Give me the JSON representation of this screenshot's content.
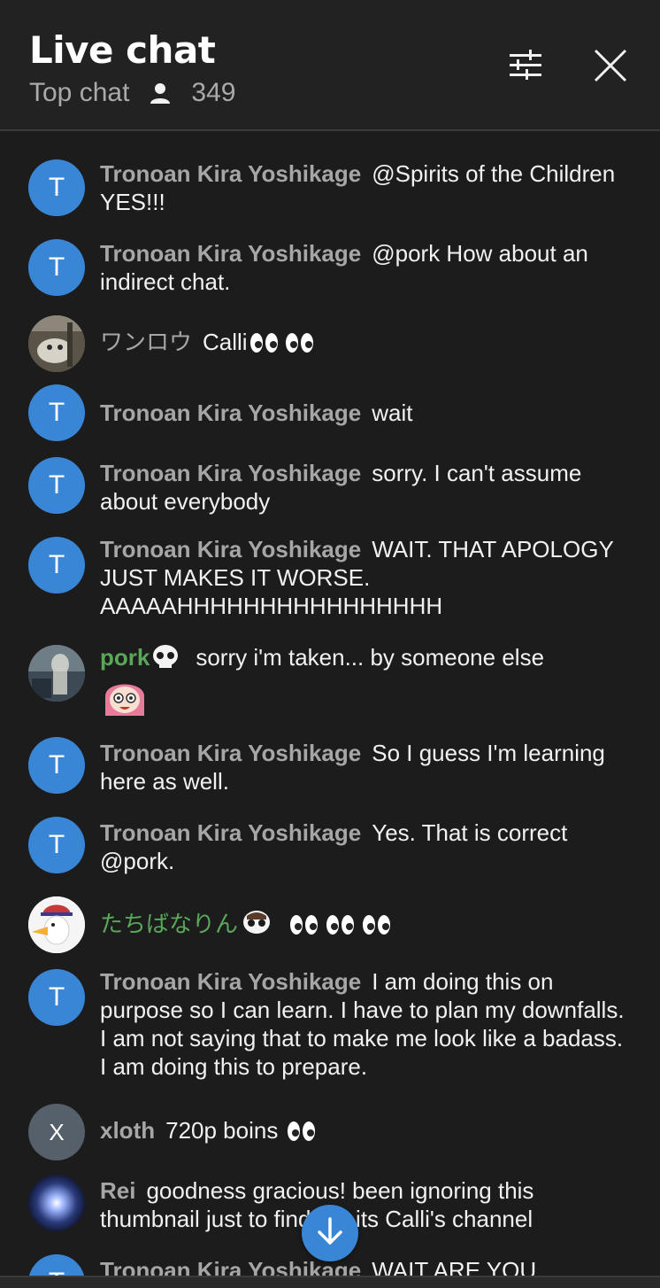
{
  "header": {
    "title": "Live chat",
    "mode_label": "Top chat",
    "viewer_count": "349"
  },
  "colors": {
    "accent": "#3a86d6",
    "author_grey": "#a6a6a6",
    "author_member_green": "#5aa75a",
    "background": "#1c1c1d"
  },
  "icons": {
    "viewers": "person-icon",
    "filter": "sliders-icon",
    "close": "close-icon",
    "scroll_down": "arrow-down-icon"
  },
  "messages": [
    {
      "avatar_letter": "T",
      "author": "Tronoan Kira Yoshikage",
      "text": "@Spirits of the Children YES!!!"
    },
    {
      "avatar_letter": "T",
      "author": "Tronoan Kira Yoshikage",
      "text": "@pork How about an indirect chat."
    },
    {
      "avatar_letter": "",
      "author": "ワンロウ",
      "text": "Calli",
      "emoji": "eyes-emoji eyes-emoji"
    },
    {
      "avatar_letter": "T",
      "author": "Tronoan Kira Yoshikage",
      "text": "wait"
    },
    {
      "avatar_letter": "T",
      "author": "Tronoan Kira Yoshikage",
      "text": "sorry. I can't assume about everybody"
    },
    {
      "avatar_letter": "T",
      "author": "Tronoan Kira Yoshikage",
      "text": "WAIT. THAT APOLOGY JUST MAKES IT WORSE. AAAAAHHHHHHHHHHHHHHHH"
    },
    {
      "avatar_letter": "",
      "author": "pork",
      "text": "sorry i'm taken... by someone else",
      "badge": "skull-badge-icon",
      "emoji": "pink-hair-girl-emote"
    },
    {
      "avatar_letter": "T",
      "author": "Tronoan Kira Yoshikage",
      "text": "So I guess I'm learning here as well."
    },
    {
      "avatar_letter": "T",
      "author": "Tronoan Kira Yoshikage",
      "text": "Yes. That is correct @pork."
    },
    {
      "avatar_letter": "",
      "author": "たちばなりん",
      "text": "",
      "badge": "skull-badge-icon",
      "emoji": "eyes-emoji eyes-emoji eyes-emoji"
    },
    {
      "avatar_letter": "T",
      "author": "Tronoan Kira Yoshikage",
      "text": "I am doing this on purpose so I can learn. I have to plan my downfalls. I am not saying that to make me look like a badass. I am doing this to prepare."
    },
    {
      "avatar_letter": "X",
      "author": "xloth",
      "text": "720p boins",
      "emoji": "eyes-emoji"
    },
    {
      "avatar_letter": "",
      "author": "Rei",
      "text": "goodness gracious! been ignoring this thumbnail just to find out its Calli's channel"
    },
    {
      "avatar_letter": "T",
      "author": "Tronoan Kira Yoshikage",
      "text": "WAIT ARE YOU"
    }
  ]
}
